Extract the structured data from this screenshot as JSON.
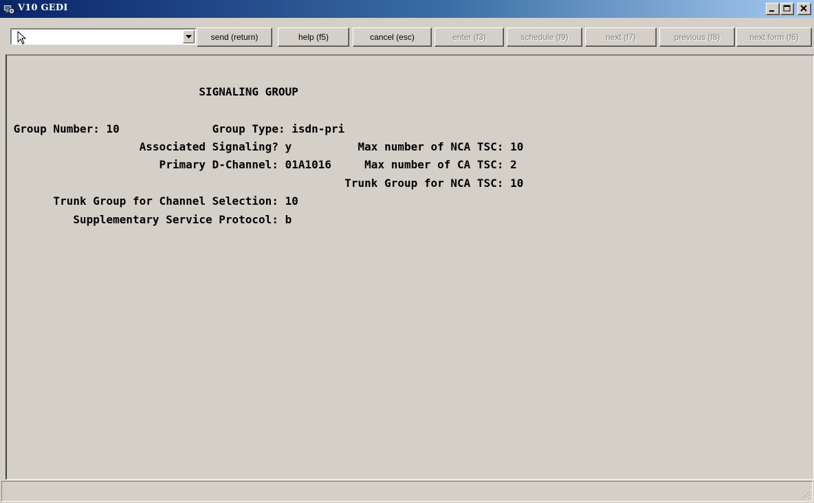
{
  "window": {
    "title": "V10 GEDI",
    "controls": {
      "minimize": "minimize-icon",
      "maximize": "maximize-icon",
      "close": "close-icon"
    }
  },
  "toolbar": {
    "command_value": "",
    "buttons": [
      {
        "label": "send (return)",
        "enabled": true
      },
      {
        "label": "help (f5)",
        "enabled": true
      },
      {
        "label": "cancel (esc)",
        "enabled": true
      },
      {
        "label": "enter (f3)",
        "enabled": false
      },
      {
        "label": "schedule (f9)",
        "enabled": false
      },
      {
        "label": "next (f7)",
        "enabled": false
      },
      {
        "label": "previous (f8)",
        "enabled": false
      },
      {
        "label": "next form (f6)",
        "enabled": false
      }
    ]
  },
  "form": {
    "lines": [
      "                             SIGNALING GROUP",
      "",
      " Group Number: 10              Group Type: isdn-pri",
      "                    Associated Signaling? y          Max number of NCA TSC: 10",
      "                       Primary D-Channel: 01A1016     Max number of CA TSC: 2",
      "                                                   Trunk Group for NCA TSC: 10",
      "       Trunk Group for Channel Selection: 10",
      "          Supplementary Service Protocol: b"
    ]
  },
  "colors": {
    "title_gradient_start": "#0a246a",
    "title_gradient_end": "#a6caf0",
    "face": "#d4d0c8",
    "disabled_text": "#808080"
  }
}
